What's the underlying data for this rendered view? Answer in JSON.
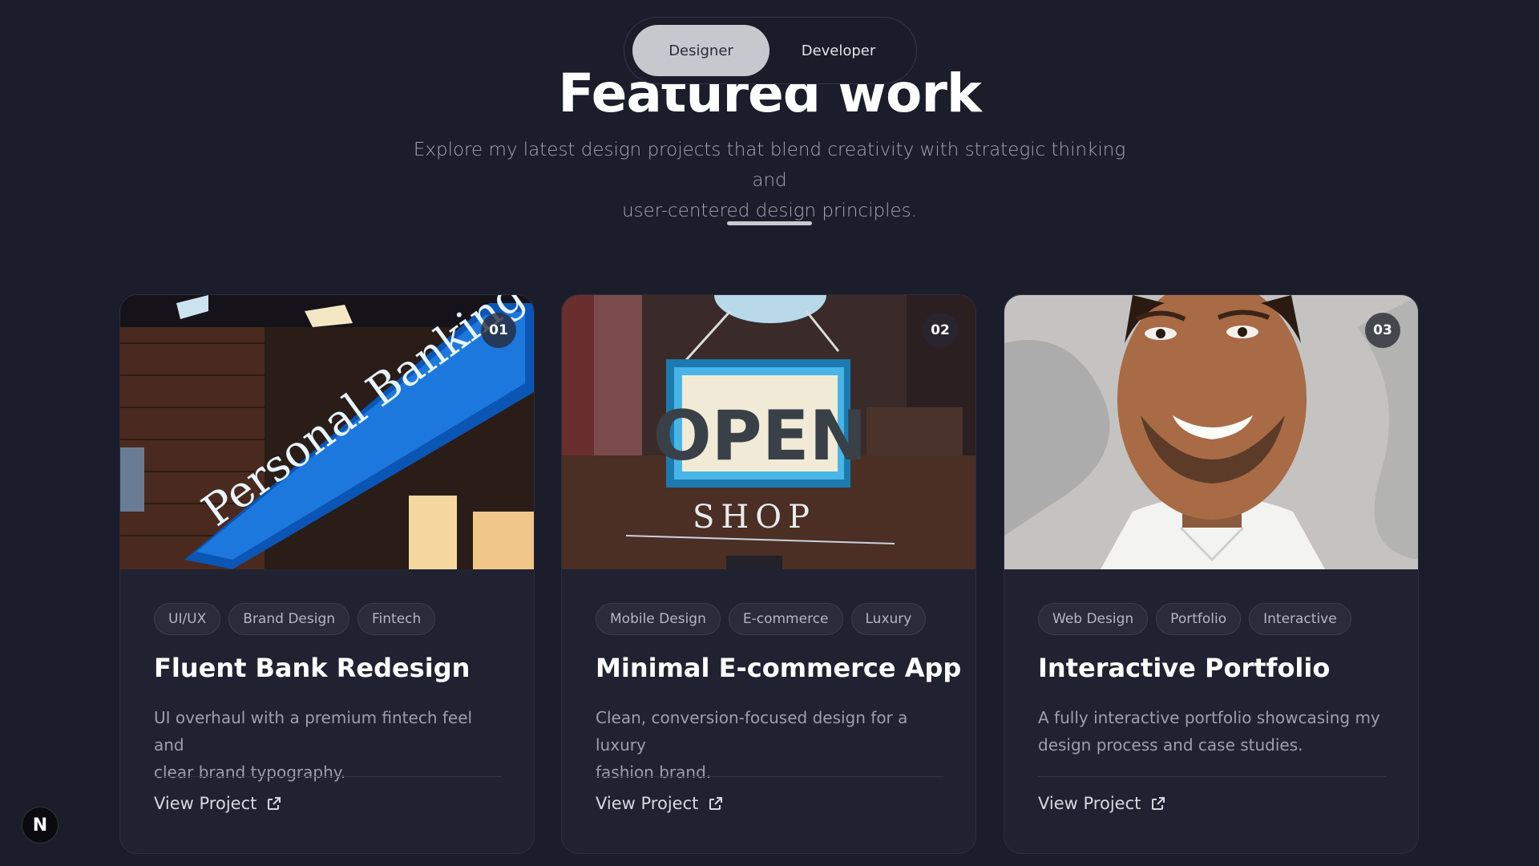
{
  "toggle": {
    "active": "Designer",
    "inactive": "Developer"
  },
  "header": {
    "title": "Featured work",
    "subtitle_line1": "Explore my latest design projects that blend creativity with strategic thinking and",
    "subtitle_line2": "user-centered design principles."
  },
  "cards": [
    {
      "number": "01",
      "tags": [
        "UI/UX",
        "Brand Design",
        "Fintech"
      ],
      "title": "Fluent Bank Redesign",
      "desc_line1": "UI overhaul with a premium fintech feel and",
      "desc_line2": "clear brand typography.",
      "cta": "View Project",
      "image_text": "Personal Banking"
    },
    {
      "number": "02",
      "tags": [
        "Mobile Design",
        "E-commerce",
        "Luxury"
      ],
      "title": "Minimal E-commerce App",
      "desc_line1": "Clean, conversion-focused design for a luxury",
      "desc_line2": "fashion brand.",
      "cta": "View Project",
      "image_text_1": "OPEN",
      "image_text_2": "SHOP"
    },
    {
      "number": "03",
      "tags": [
        "Web Design",
        "Portfolio",
        "Interactive"
      ],
      "title": "Interactive Portfolio",
      "desc_line1": "A fully interactive portfolio showcasing my",
      "desc_line2": "design process and case studies.",
      "cta": "View Project"
    }
  ],
  "fab": {
    "label": "N"
  },
  "icons": {
    "external": "external-link-icon"
  }
}
